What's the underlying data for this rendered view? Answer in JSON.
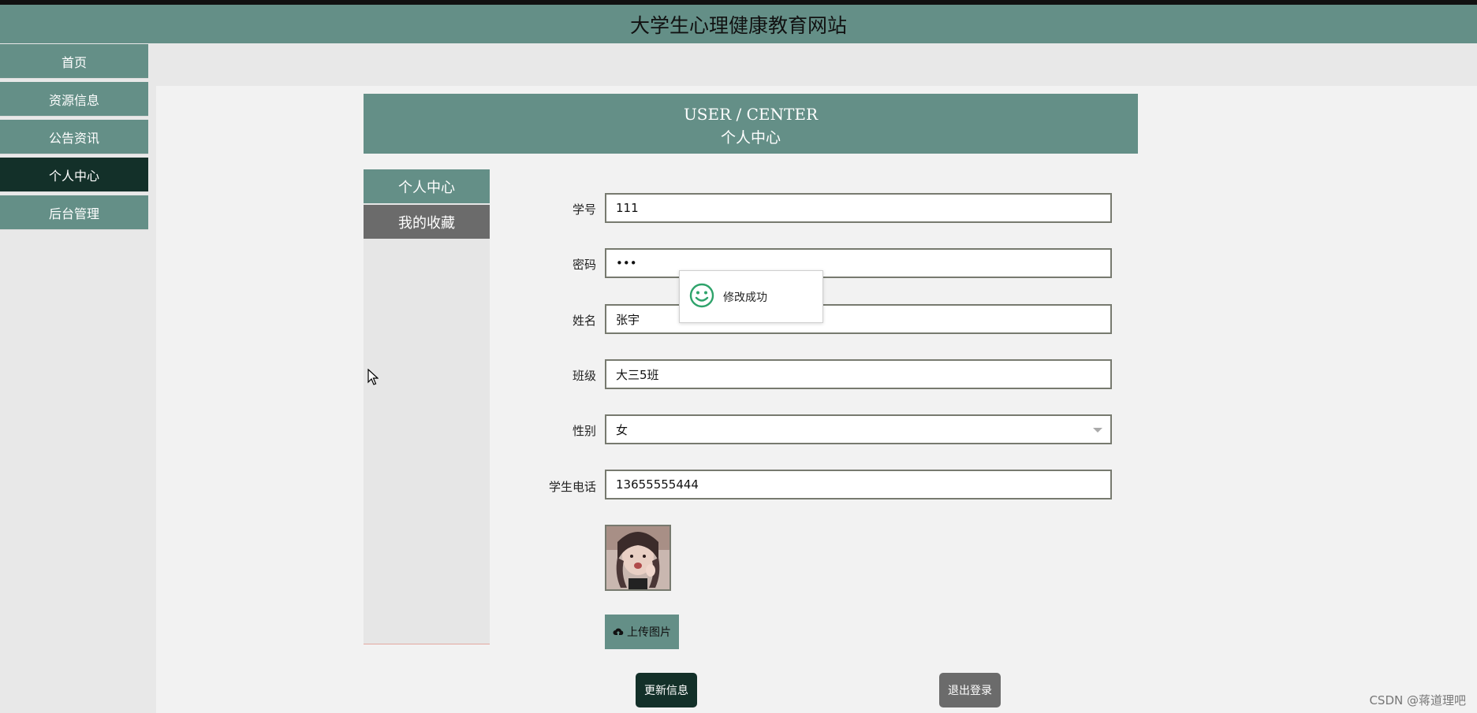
{
  "site_title": "大学生心理健康教育网站",
  "nav": [
    {
      "label": "首页"
    },
    {
      "label": "资源信息"
    },
    {
      "label": "公告资讯"
    },
    {
      "label": "个人中心"
    },
    {
      "label": "后台管理"
    }
  ],
  "user_center": {
    "title_en": "USER / CENTER",
    "title_zh": "个人中心"
  },
  "tabs": [
    {
      "label": "个人中心"
    },
    {
      "label": "我的收藏"
    }
  ],
  "form": {
    "student_id": {
      "label": "学号",
      "value": "111"
    },
    "password": {
      "label": "密码",
      "value": "•••"
    },
    "name": {
      "label": "姓名",
      "value": "张宇"
    },
    "class": {
      "label": "班级",
      "value": "大三5班"
    },
    "gender": {
      "label": "性别",
      "value": "女"
    },
    "phone": {
      "label": "学生电话",
      "value": "13655555444"
    }
  },
  "upload_label": "上传图片",
  "update_label": "更新信息",
  "logout_label": "退出登录",
  "toast_text": "修改成功",
  "watermark": "CSDN @蒋道理吧",
  "colors": {
    "primary": "#648f87",
    "active": "#133029",
    "gray_button": "#6b6b6b"
  }
}
